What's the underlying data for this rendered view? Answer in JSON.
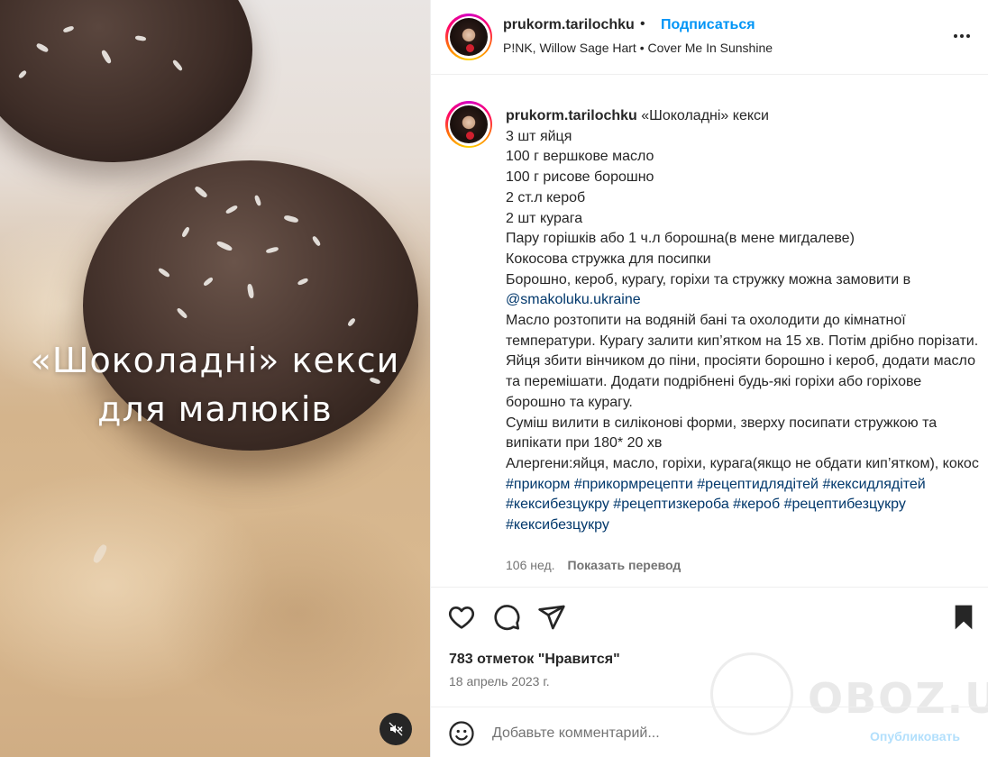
{
  "media": {
    "overlay_line1": "«Шоколадні» кекси",
    "overlay_line2": "для малюків",
    "mute_icon": "speaker-muted-icon"
  },
  "header": {
    "username": "prukorm.tarilochku",
    "separator": "•",
    "follow_label": "Подписаться",
    "audio": "P!NK, Willow Sage Hart • Cover Me In Sunshine",
    "more_icon": "more-options-icon"
  },
  "caption": {
    "username": "prukorm.tarilochku",
    "lines": [
      "«Шоколадні» кекси",
      "3 шт яйця",
      "100 г вершкове масло",
      "100 г рисове борошно",
      "2 ст.л кероб",
      "2 шт курага",
      "Пару горішків або 1 ч.л борошна(в мене мигдалеве)",
      "Кокосова стружка для посипки",
      "Борошно, кероб, курагу, горіхи та стружку можна замовити в",
      "@smakoluku.ukraine",
      "Масло розтопити на водяній бані та охолодити до кімнатної температури. Курагу залити кип’ятком на 15 хв. Потім дрібно порізати. Яйця збити вінчиком до піни, просіяти борошно і кероб, додати масло та перемішати. Додати подрібнені будь-які горіхи або горіхове борошно та курагу.",
      "Суміш вилити в силіконові форми, зверху посипати стружкою та випікати при 180* 20 хв",
      "Алергени:яйця, масло, горіхи, курага(якщо не обдати кип’ятком), кокос"
    ],
    "hashtags": [
      "#прикорм",
      "#прикормрецепти",
      "#рецептидлядітей",
      "#кексидлядітей",
      "#кексибезцукру",
      "#рецептизкероба",
      "#кероб",
      "#рецептибезцукру",
      "#кексибезцукру"
    ],
    "age": "106 нед.",
    "translate_label": "Показать перевод"
  },
  "actions": {
    "like_icon": "heart-icon",
    "comment_icon": "comment-icon",
    "share_icon": "send-icon",
    "save_icon": "bookmark-icon"
  },
  "stats": {
    "likes": "783 отметок \"Нравится\"",
    "date": "18 апрель 2023 г."
  },
  "comment": {
    "placeholder": "Добавьте комментарий...",
    "publish_label": "Опубликовать",
    "emoji_icon": "emoji-icon"
  },
  "watermark": {
    "text": "OBOZ.UA"
  },
  "colors": {
    "link": "#00376b",
    "follow": "#0095f6",
    "publish_disabled": "#b2dffc",
    "muted_text": "#737373",
    "text": "#262626"
  }
}
